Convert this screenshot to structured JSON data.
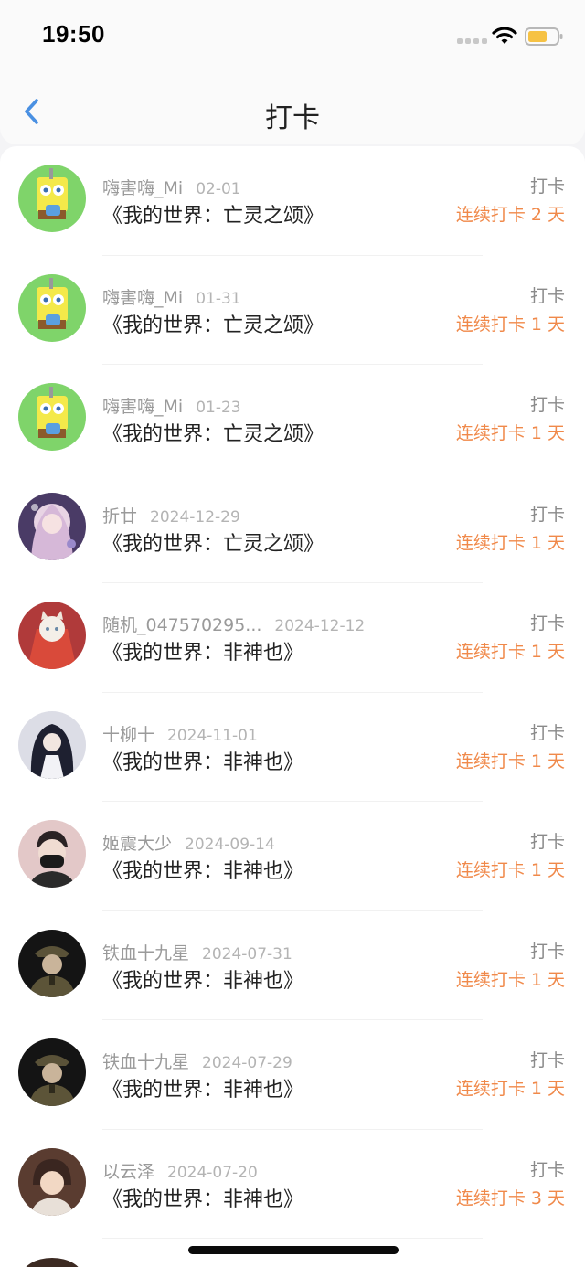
{
  "status_bar": {
    "time": "19:50"
  },
  "nav": {
    "title": "打卡"
  },
  "colors": {
    "accent": "#f0894a",
    "back_arrow": "#4a90e2",
    "battery": "#f6c244"
  },
  "entries": [
    {
      "user": "嗨害嗨_Mi",
      "date": "02-01",
      "title": "《我的世界：亡灵之颂》",
      "action": "打卡",
      "streak": "连续打卡 2 天",
      "avatar": "spongebob-avatar"
    },
    {
      "user": "嗨害嗨_Mi",
      "date": "01-31",
      "title": "《我的世界：亡灵之颂》",
      "action": "打卡",
      "streak": "连续打卡 1 天",
      "avatar": "spongebob-avatar"
    },
    {
      "user": "嗨害嗨_Mi",
      "date": "01-23",
      "title": "《我的世界：亡灵之颂》",
      "action": "打卡",
      "streak": "连续打卡 1 天",
      "avatar": "spongebob-avatar"
    },
    {
      "user": "折廿",
      "date": "2024-12-29",
      "title": "《我的世界：亡灵之颂》",
      "action": "打卡",
      "streak": "连续打卡 1 天",
      "avatar": "anime-girl-avatar"
    },
    {
      "user": "随机_047570295...",
      "date": "2024-12-12",
      "title": "《我的世界：非神也》",
      "action": "打卡",
      "streak": "连续打卡 1 天",
      "avatar": "cat-avatar"
    },
    {
      "user": "十柳十",
      "date": "2024-11-01",
      "title": "《我的世界：非神也》",
      "action": "打卡",
      "streak": "连续打卡 1 天",
      "avatar": "dark-hair-avatar"
    },
    {
      "user": "姬震大少",
      "date": "2024-09-14",
      "title": "《我的世界：非神也》",
      "action": "打卡",
      "streak": "连续打卡 1 天",
      "avatar": "masked-man-avatar"
    },
    {
      "user": "铁血十九星",
      "date": "2024-07-31",
      "title": "《我的世界：非神也》",
      "action": "打卡",
      "streak": "连续打卡 1 天",
      "avatar": "soldier-avatar"
    },
    {
      "user": "铁血十九星",
      "date": "2024-07-29",
      "title": "《我的世界：非神也》",
      "action": "打卡",
      "streak": "连续打卡 1 天",
      "avatar": "soldier-avatar"
    },
    {
      "user": "以云泽",
      "date": "2024-07-20",
      "title": "《我的世界：非神也》",
      "action": "打卡",
      "streak": "连续打卡 3 天",
      "avatar": "anime-boy-avatar"
    }
  ]
}
